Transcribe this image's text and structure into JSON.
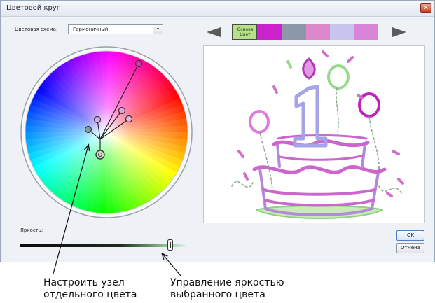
{
  "window": {
    "title": "Цветовой круг",
    "close_label": "✕"
  },
  "scheme": {
    "label": "Цветовая схема:",
    "value": "Гармоничный",
    "arrow": "▾"
  },
  "swatches": {
    "base_label_line1": "Основа",
    "base_label_line2": "Цвет",
    "colors": [
      "#b8e08a",
      "#cc22cc",
      "#8a98a8",
      "#dd88cc",
      "#c9c4ec",
      "#d884d8"
    ]
  },
  "brightness": {
    "label": "Яркость:",
    "level": 0.9
  },
  "buttons": {
    "ok": "OK",
    "cancel": "Отмена"
  },
  "callouts": {
    "left_line1": "Настроить узел",
    "left_line2": "отдельного цвета",
    "right_line1": "Управление яркостью",
    "right_line2": "выбранного цвета"
  },
  "colors": {
    "dialog_bg": "#eef1f6",
    "accent": "#4f80bd"
  },
  "icons": [
    "close-icon",
    "chevron-down-icon",
    "arrow-left-icon",
    "arrow-right-icon"
  ]
}
